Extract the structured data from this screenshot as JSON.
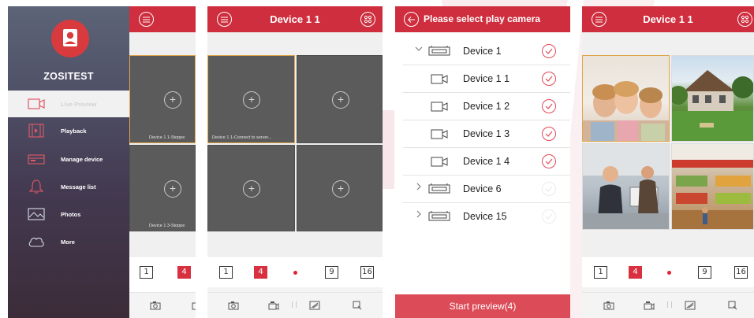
{
  "colors": {
    "brand_red": "#cf2e3e",
    "selection_gold": "#e0a54a",
    "check_red": "#e04a57"
  },
  "panel1": {
    "app_name": "ZOSITEST",
    "menu": [
      {
        "label": "Live Preview",
        "icon": "camera-icon",
        "active": true
      },
      {
        "label": "Playback",
        "icon": "film-icon"
      },
      {
        "label": "Manage device",
        "icon": "dvr-icon"
      },
      {
        "label": "Message list",
        "icon": "bell-icon"
      },
      {
        "label": "Photos",
        "icon": "photo-icon"
      },
      {
        "label": "More",
        "icon": "cloud-icon"
      }
    ],
    "cells": [
      "Device 1 1-Stoppe",
      "Device 1 3-Stoppe"
    ],
    "layout_buttons": [
      "1",
      "4"
    ]
  },
  "panel2": {
    "title": "Device 1 1",
    "cells": [
      "Device 1 1-Connect to server...",
      "",
      "",
      ""
    ],
    "layout_buttons": [
      "1",
      "4",
      "9",
      "16"
    ]
  },
  "panel3": {
    "title": "Please select play camera",
    "items": [
      {
        "name": "Device 1",
        "type": "device",
        "expanded": true,
        "checked": true
      },
      {
        "name": "Device 1 1",
        "type": "camera",
        "checked": true
      },
      {
        "name": "Device 1 2",
        "type": "camera",
        "checked": true
      },
      {
        "name": "Device 1 3",
        "type": "camera",
        "checked": true
      },
      {
        "name": "Device 1 4",
        "type": "camera",
        "checked": true
      },
      {
        "name": "Device 6",
        "type": "device",
        "expanded": false,
        "checked": false
      },
      {
        "name": "Device 15",
        "type": "device",
        "expanded": false,
        "checked": false
      }
    ],
    "start_button": "Start preview(4)"
  },
  "panel4": {
    "title": "Device 1 1",
    "layout_buttons": [
      "1",
      "4",
      "9",
      "16"
    ]
  }
}
